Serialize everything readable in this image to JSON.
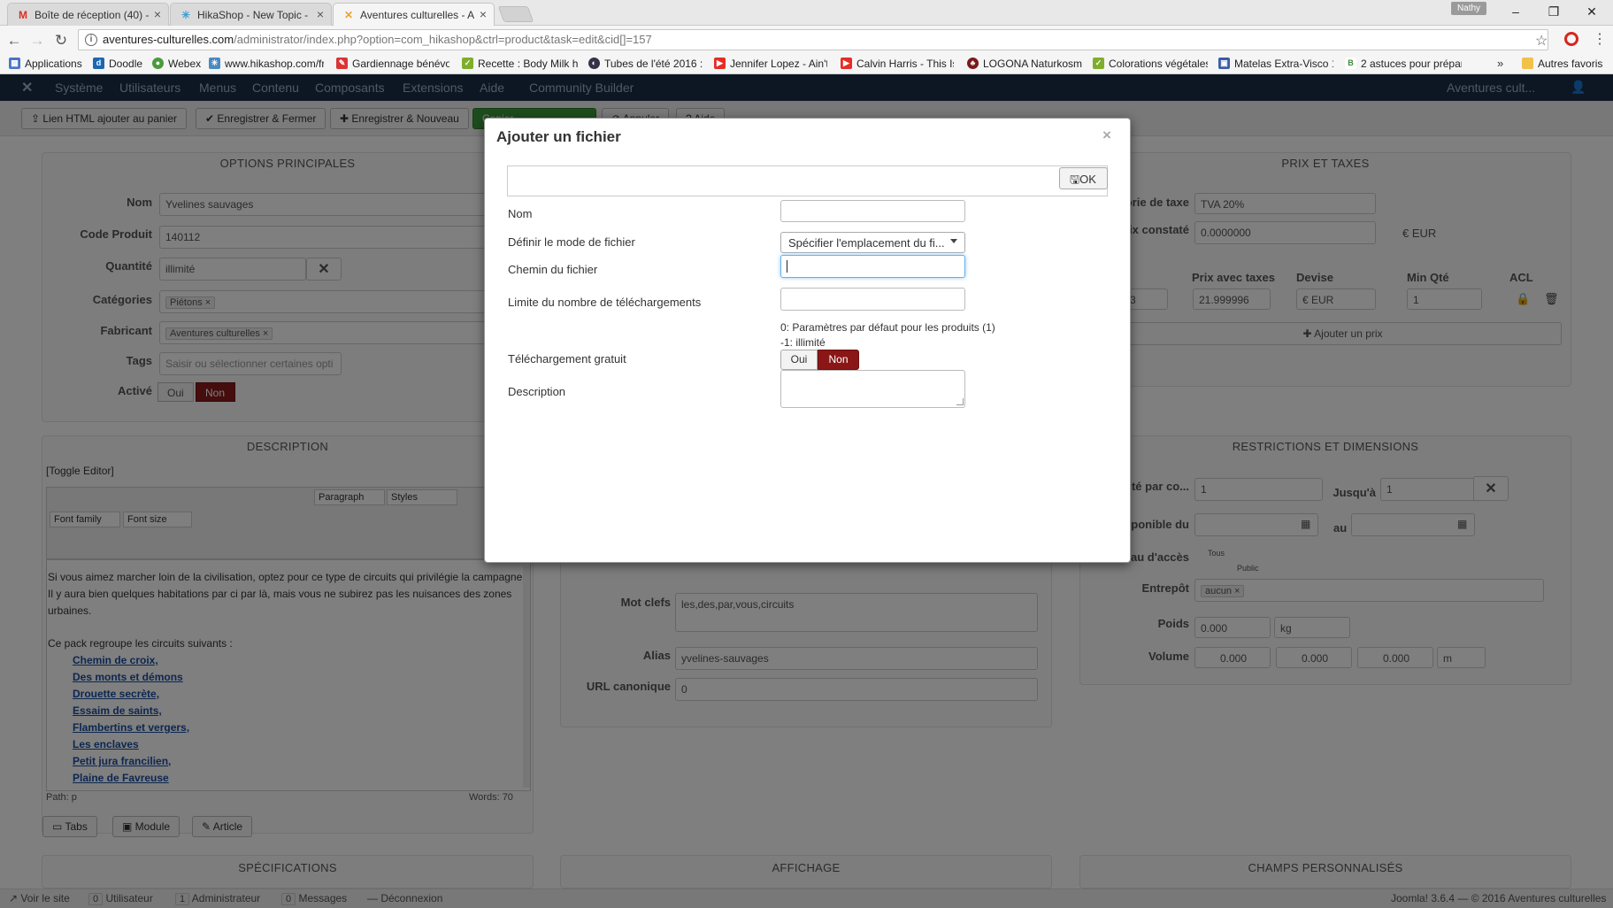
{
  "browser": {
    "tabs": [
      {
        "title": "Boîte de réception (40) -",
        "favicon": "gmail-icon"
      },
      {
        "title": "HikaShop - New Topic -",
        "favicon": "hikashop-icon"
      },
      {
        "title": "Aventures culturelles - A",
        "favicon": "joomla-icon"
      }
    ],
    "profile_name": "Nathy",
    "url_host": "aventures-culturelles.com",
    "url_path": "/administrator/index.php?option=com_hikashop&ctrl=product&task=edit&cid[]=157",
    "bookmarks": [
      "Applications",
      "Doodle",
      "Webex",
      "www.hikashop.com/fr",
      "Gardiennage bénévol",
      "Recette : Body Milk h",
      "Tubes de l'été 2016 :",
      "Jennifer Lopez - Ain't",
      "Calvin Harris - This Is",
      "LOGONA Naturkosme",
      "Colorations végétales",
      "Matelas Extra-Visco 1",
      "2 astuces pour prépar"
    ],
    "bookmarks_more": "»",
    "other_bookmarks": "Autres favoris"
  },
  "admin": {
    "menu": [
      "Système",
      "Utilisateurs",
      "Menus",
      "Contenu",
      "Composants",
      "Extensions",
      "Aide",
      "Community Builder"
    ],
    "site_name": "Aventures cult...",
    "toolbar": [
      "Lien HTML ajouter au panier",
      "Enregistrer & Fermer",
      "Enregistrer & Nouveau",
      "Copier",
      "Annuler",
      "Aide"
    ],
    "options_title": "OPTIONS PRINCIPALES",
    "labels": {
      "nom": "Nom",
      "code": "Code Produit",
      "quantite": "Quantité",
      "categories": "Catégories",
      "fabricant": "Fabricant",
      "tags": "Tags",
      "active": "Activé"
    },
    "values": {
      "nom": "Yvelines sauvages",
      "code": "140112",
      "quantite": "illimité",
      "categorie": "Piétons",
      "fabricant": "Aventures culturelles",
      "tags_placeholder": "Saisir ou sélectionner certaines opti"
    },
    "toggle_oui": "Oui",
    "toggle_non": "Non",
    "prix_title": "PRIX ET TAXES",
    "prix": {
      "taxe_label": "Catégorie de taxe",
      "taxe_value": "TVA 20%",
      "constate_label": "Prix constaté",
      "constate_value": "0.0000000",
      "currency": "€ EUR",
      "col_avec_taxes": "Prix avec taxes",
      "col_devise": "Devise",
      "col_min": "Min Qté",
      "col_acl": "ACL",
      "row_prix_ht": "3",
      "row_prix_taxes": "21.999996",
      "row_devise": "€ EUR",
      "row_min": "1",
      "add_price": "Ajouter un prix"
    },
    "description_title": "DESCRIPTION",
    "toggle_editor": "[Toggle Editor]",
    "editor": {
      "font_family": "Font family",
      "font_size": "Font size",
      "paragraph": "Paragraph",
      "styles": "Styles"
    },
    "desc_lines": [
      "Si vous aimez marcher loin de la civilisation, optez pour ce type de circuits qui privilégie la campagne.",
      "Il y aura bien quelques habitations par ci par là, mais vous ne subirez pas les nuisances des zones",
      "urbaines.",
      "Ce pack regroupe les circuits suivants :"
    ],
    "desc_links": [
      "Chemin de croix,",
      "Des monts et démons",
      "Drouette secrète,",
      "Essaim de saints,",
      "Flambertins et vergers,",
      "Les enclaves",
      "Petit jura francilien,",
      "Plaine de Favreuse"
    ],
    "path": "Path: p",
    "words": "Words: 70",
    "editor_buttons": [
      "Tabs",
      "Module",
      "Article"
    ],
    "meta": {
      "mot_clefs_label": "Mot clefs",
      "mot_clefs_value": "les,des,par,vous,circuits",
      "alias_label": "Alias",
      "alias_value": "yvelines-sauvages",
      "url_label": "URL canonique",
      "url_value": "0"
    },
    "restrictions_title": "RESTRICTIONS ET DIMENSIONS",
    "restrictions": {
      "qte_label": "Quantité par co...",
      "qte_value": "1",
      "jusqua_label": "Jusqu'à",
      "jusqua_value": "1",
      "dispo_label": "Disponible du",
      "au_label": "au",
      "acces_label": "Niveau d'accès",
      "acces_tous": "Tous",
      "acces_public": "Public",
      "entrepot_label": "Entrepôt",
      "entrepot_value": "aucun",
      "poids_label": "Poids",
      "poids_value": "0.000",
      "poids_unit": "kg",
      "volume_label": "Volume",
      "volume_value": "0.000",
      "volume_unit": "m"
    },
    "bottom_panels": [
      "SPÉCIFICATIONS",
      "AFFICHAGE",
      "CHAMPS PERSONNALISÉS"
    ],
    "footer": {
      "voir": "Voir le site",
      "visitors": "Utilisateur",
      "admins": "Administrateur",
      "messages": "Messages",
      "logout": "Déconnexion",
      "version": "Joomla! 3.6.4 — © 2016 Aventures culturelles",
      "visitor_count": "0",
      "admin_count": "1",
      "msg_count": "0"
    }
  },
  "modal": {
    "title": "Ajouter un fichier",
    "close": "×",
    "ok_label": "OK",
    "fields": {
      "nom_label": "Nom",
      "mode_label": "Définir le mode de fichier",
      "mode_value": "Spécifier l'emplacement du fi...",
      "path_label": "Chemin du fichier",
      "limit_label": "Limite du nombre de téléchargements",
      "limit_hint1": "0: Paramètres par défaut pour les produits (1)",
      "limit_hint2": "-1: illimité",
      "free_label": "Téléchargement gratuit",
      "free_oui": "Oui",
      "free_non": "Non",
      "description_label": "Description"
    }
  },
  "colors": {
    "accent": "#8b1616",
    "admin_nav": "#1b2f47",
    "focus": "#66afe9"
  }
}
